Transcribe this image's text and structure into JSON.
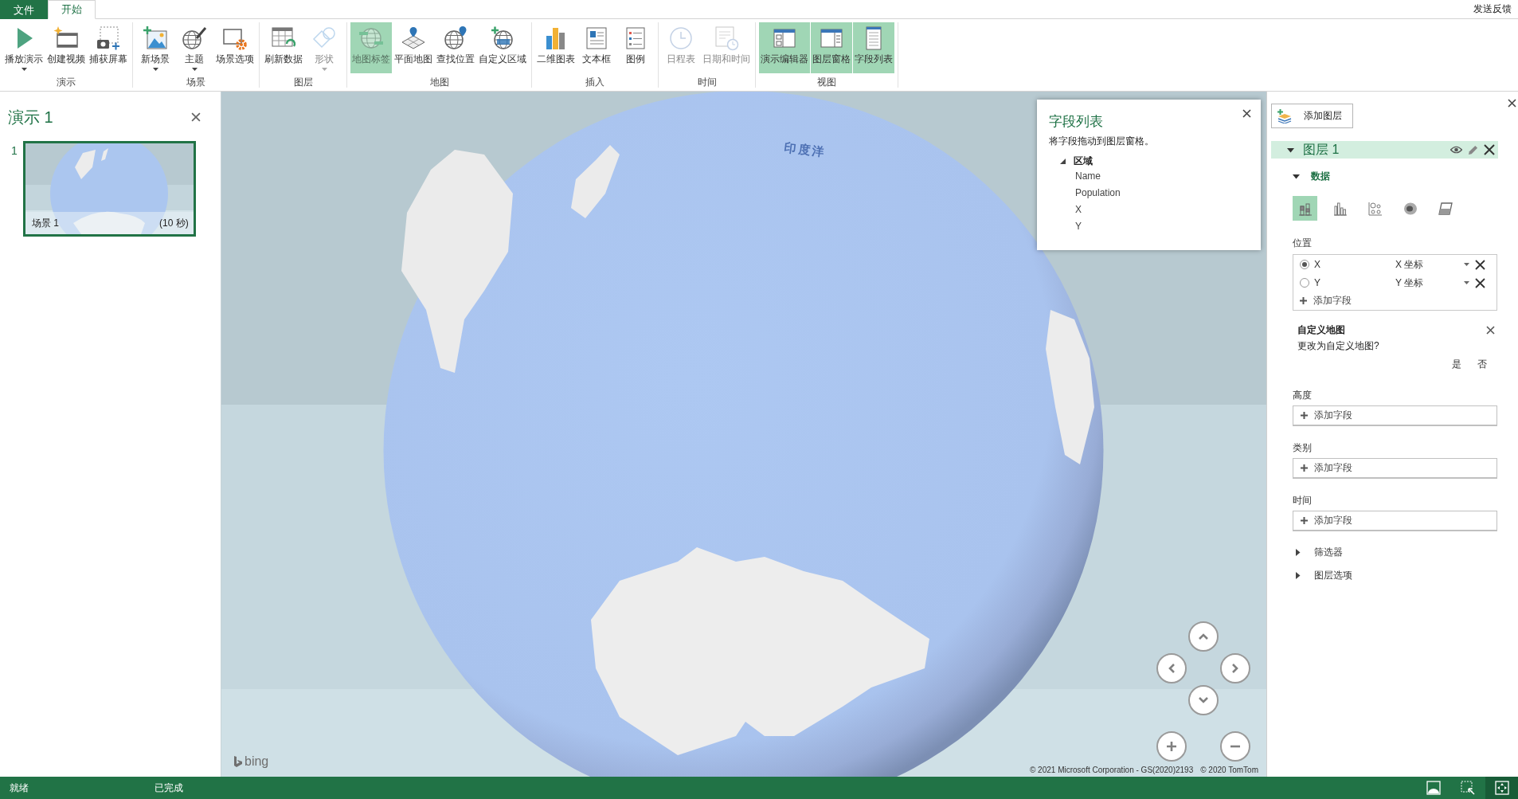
{
  "tabs": [
    {
      "label": "文件",
      "kind": "file",
      "selected": false
    },
    {
      "label": "开始",
      "kind": "tab",
      "selected": true
    }
  ],
  "feedback": "发送反馈",
  "ribbon": {
    "groups": [
      {
        "label": "演示",
        "buttons": [
          {
            "label": "播放演示",
            "menu": true,
            "disabled": false,
            "pressed": false
          },
          {
            "label": "创建视频",
            "menu": false,
            "disabled": false,
            "pressed": false
          },
          {
            "label": "捕获屏幕",
            "menu": false,
            "disabled": false,
            "pressed": false
          }
        ]
      },
      {
        "label": "场景",
        "buttons": [
          {
            "label": "新场景",
            "menu": true,
            "disabled": false,
            "pressed": false
          },
          {
            "label": "主题",
            "menu": true,
            "disabled": false,
            "pressed": false
          },
          {
            "label": "场景选项",
            "menu": false,
            "disabled": false,
            "pressed": false
          }
        ]
      },
      {
        "label": "图层",
        "buttons": [
          {
            "label": "刷新数据",
            "menu": false,
            "disabled": false,
            "pressed": false
          },
          {
            "label": "形状",
            "menu": true,
            "disabled": true,
            "pressed": false
          }
        ]
      },
      {
        "label": "地图",
        "buttons": [
          {
            "label": "地图标签",
            "menu": false,
            "disabled": true,
            "pressed": true
          },
          {
            "label": "平面地图",
            "menu": false,
            "disabled": false,
            "pressed": false
          },
          {
            "label": "查找位置",
            "menu": false,
            "disabled": false,
            "pressed": false
          },
          {
            "label": "自定义区域",
            "menu": false,
            "disabled": false,
            "pressed": false
          }
        ]
      },
      {
        "label": "插入",
        "buttons": [
          {
            "label": "二维图表",
            "menu": false,
            "disabled": false,
            "pressed": false
          },
          {
            "label": "文本框",
            "menu": false,
            "disabled": false,
            "pressed": false
          },
          {
            "label": "图例",
            "menu": false,
            "disabled": false,
            "pressed": false
          }
        ]
      },
      {
        "label": "时间",
        "buttons": [
          {
            "label": "日程表",
            "menu": false,
            "disabled": true,
            "pressed": false
          },
          {
            "label": "日期和时间",
            "menu": false,
            "disabled": true,
            "pressed": false
          }
        ]
      },
      {
        "label": "视图",
        "buttons": [
          {
            "label": "演示编辑器",
            "menu": false,
            "disabled": false,
            "pressed": true
          },
          {
            "label": "图层窗格",
            "menu": false,
            "disabled": false,
            "pressed": true
          },
          {
            "label": "字段列表",
            "menu": false,
            "disabled": false,
            "pressed": true
          }
        ]
      }
    ]
  },
  "tour_panel": {
    "title": "演示 1",
    "scenes": [
      {
        "number": "1",
        "name": "场景 1",
        "duration": "(10 秒)",
        "selected": true
      }
    ]
  },
  "map": {
    "labels": [
      "印度洋"
    ],
    "logo": "bing",
    "attribution": [
      "© 2021 Microsoft Corporation - GS(2020)2193",
      "© 2020 TomTom"
    ]
  },
  "field_list": {
    "title": "字段列表",
    "hint": "将字段拖动到图层窗格。",
    "tables": [
      {
        "label": "区域",
        "expanded": true,
        "children": [
          {
            "label": "Name"
          },
          {
            "label": "Population"
          },
          {
            "label": "X"
          },
          {
            "label": "Y"
          }
        ]
      }
    ]
  },
  "layer_pane": {
    "add_layer": "添加图层",
    "layer": {
      "name": "图层 1",
      "expanded": true
    },
    "data": {
      "label": "数据",
      "expanded": true
    },
    "chart_types": [
      {
        "selected": true
      },
      {
        "selected": false
      },
      {
        "selected": false
      },
      {
        "selected": false
      },
      {
        "selected": false
      }
    ],
    "location": {
      "label": "位置",
      "fields": [
        {
          "name": "X",
          "type": "X 坐标",
          "selected": true
        },
        {
          "name": "Y",
          "type": "Y 坐标",
          "selected": false
        }
      ],
      "add": "添加字段"
    },
    "custom_map": {
      "title": "自定义地图",
      "question": "更改为自定义地图?",
      "yes": "是",
      "no": "否"
    },
    "wells": [
      {
        "label": "高度",
        "add": "添加字段"
      },
      {
        "label": "类别",
        "add": "添加字段"
      },
      {
        "label": "时间",
        "add": "添加字段"
      }
    ],
    "sections": [
      {
        "label": "筛选器",
        "expanded": false
      },
      {
        "label": "图层选项",
        "expanded": false
      }
    ]
  },
  "status_bar": {
    "texts": [
      "就绪",
      "已完成"
    ],
    "views": [
      {
        "selected": false
      },
      {
        "selected": false
      },
      {
        "selected": true
      }
    ]
  }
}
